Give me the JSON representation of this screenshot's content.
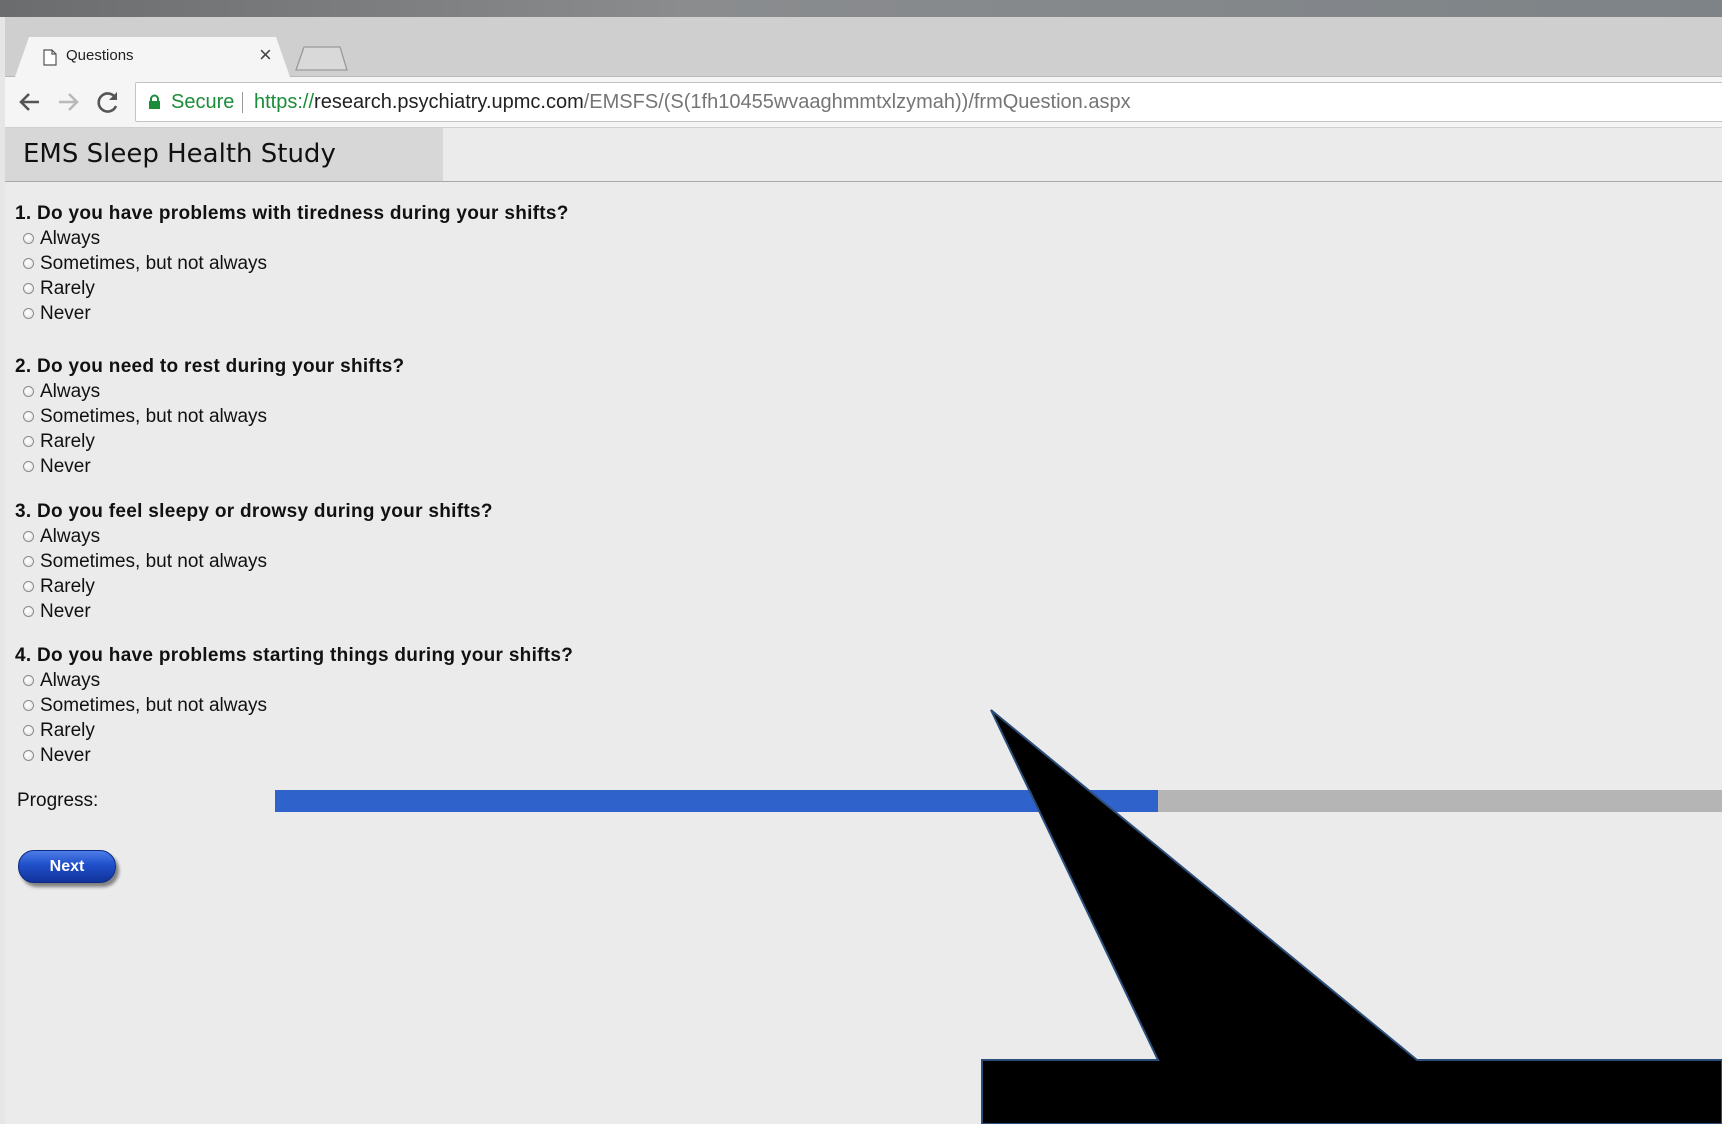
{
  "browser": {
    "tab_title": "Questions",
    "tab_close_glyph": "×",
    "secure_label": "Secure",
    "url_scheme": "https://",
    "url_host": "research.psychiatry.upmc.com",
    "url_path": "/EMSFS/(S(1fh10455wvaaghmmtxlzymah))/frmQuestion.aspx",
    "icons": [
      "page-icon",
      "close-icon",
      "back-arrow-icon",
      "forward-arrow-icon",
      "reload-icon",
      "lock-icon"
    ]
  },
  "page": {
    "site_title": "EMS Sleep Health Study",
    "questions": [
      {
        "text": "1. Do you have problems with tiredness during your shifts?",
        "options": [
          "Always",
          "Sometimes, but not always",
          "Rarely",
          "Never"
        ]
      },
      {
        "text": "2. Do you need to rest during your shifts?",
        "options": [
          "Always",
          "Sometimes, but not always",
          "Rarely",
          "Never"
        ]
      },
      {
        "text": "3. Do you feel sleepy or drowsy during your shifts?",
        "options": [
          "Always",
          "Sometimes, but not always",
          "Rarely",
          "Never"
        ]
      },
      {
        "text": "4. Do you have problems starting things during your shifts?",
        "options": [
          "Always",
          "Sometimes, but not always",
          "Rarely",
          "Never"
        ]
      }
    ],
    "progress_label": "Progress:",
    "progress_fraction": 0.61,
    "next_label": "Next"
  },
  "colors": {
    "progress_fill": "#3062cc",
    "progress_track": "#b5b5b5",
    "secure_green": "#1b8c39",
    "page_background": "#ebebeb"
  }
}
